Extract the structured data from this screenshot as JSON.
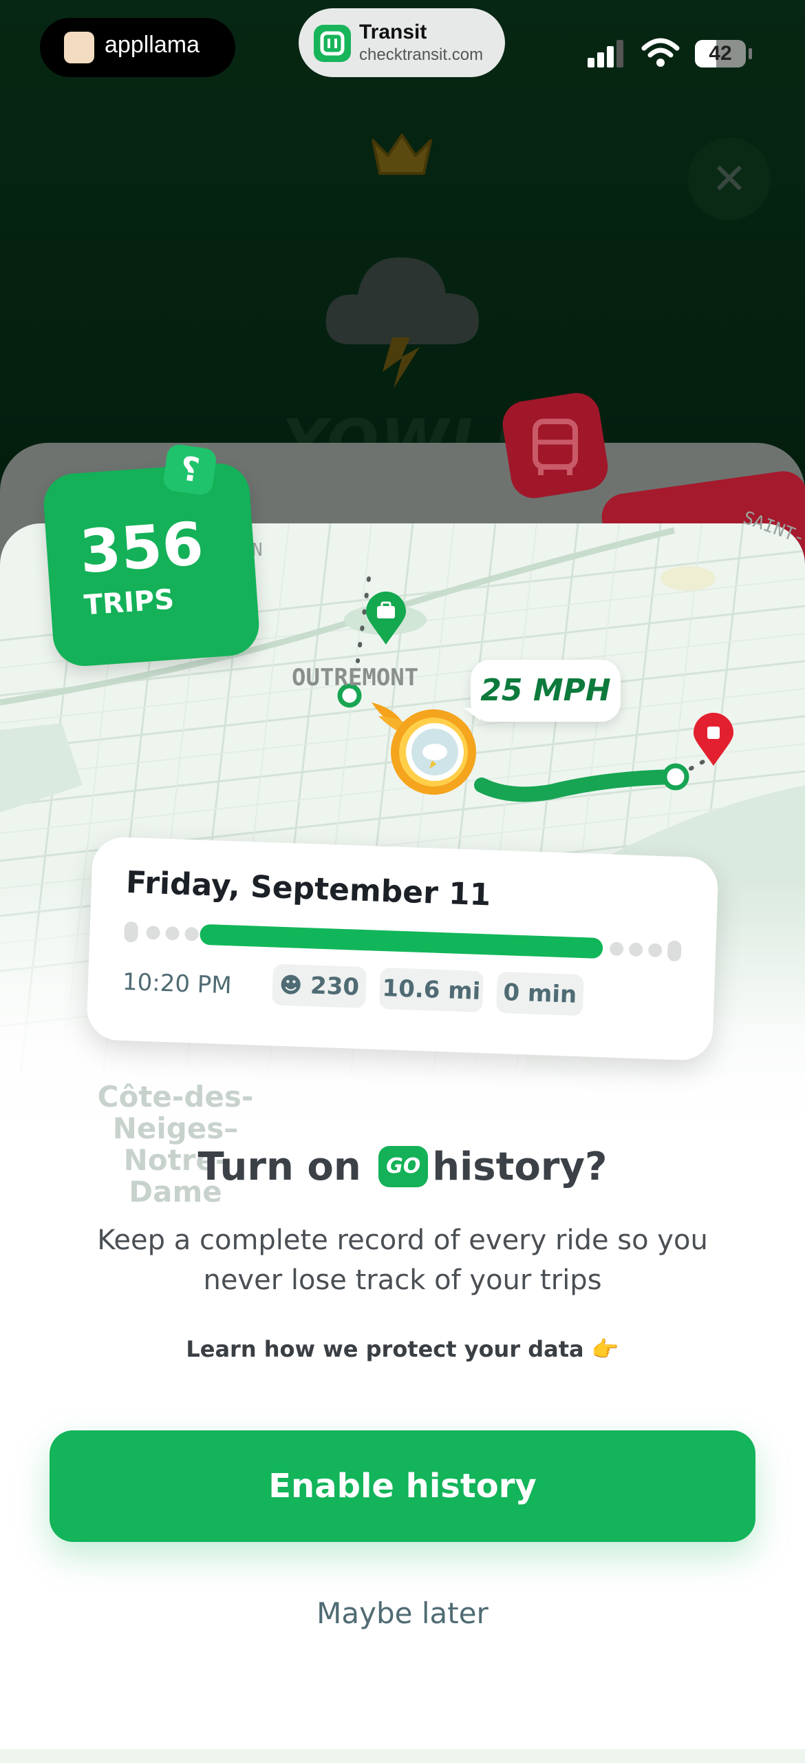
{
  "status_bar": {
    "left_app": "appllama",
    "source_app_name": "Transit",
    "source_app_url": "checktransit.com",
    "battery_level": "42"
  },
  "map": {
    "neighborhood_label": "OUTREMONT",
    "edge_label_right": "SAINT-",
    "edge_label_left": "N",
    "faded_label": "Côte-des-Neiges–Notre-Dame"
  },
  "trips_badge": {
    "count": "356",
    "label": "TRIPS",
    "icon_glyph": "⸮"
  },
  "speed_bubble": {
    "text": "25 MPH"
  },
  "trip_card": {
    "date": "Friday, September 11",
    "time": "10:20 PM",
    "points": "230",
    "points_icon": "☻",
    "distance": "10.6 mi",
    "delay": "0 min"
  },
  "prompt": {
    "headline_before": "Turn on",
    "go_badge": "GO",
    "headline_after": "history?",
    "body": "Keep a complete record of every ride so you never lose track of your trips",
    "learn_link": "Learn how we protect your data 👉",
    "primary_button": "Enable history",
    "secondary_button": "Maybe later"
  },
  "colors": {
    "brand_green": "#14b158",
    "background_dark": "#062713",
    "destination_red": "#e3202f"
  }
}
